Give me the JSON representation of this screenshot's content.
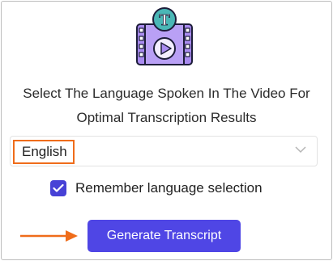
{
  "heading": {
    "line1": "Select The Language Spoken In The Video For",
    "line2": "Optimal Transcription Results"
  },
  "language_select": {
    "selected": "English",
    "arrow_icon": "chevron-down-icon"
  },
  "remember": {
    "label": "Remember language selection",
    "checked": true
  },
  "generate_button": {
    "label": "Generate Transcript"
  },
  "logo": {
    "badge_letter": "T",
    "icon": "video-transcript-logo-icon"
  },
  "colors": {
    "accent": "#4f46e5",
    "highlight": "#ef6c1a",
    "logo_purple": "#a98bf0",
    "logo_teal": "#4ab7b6"
  }
}
